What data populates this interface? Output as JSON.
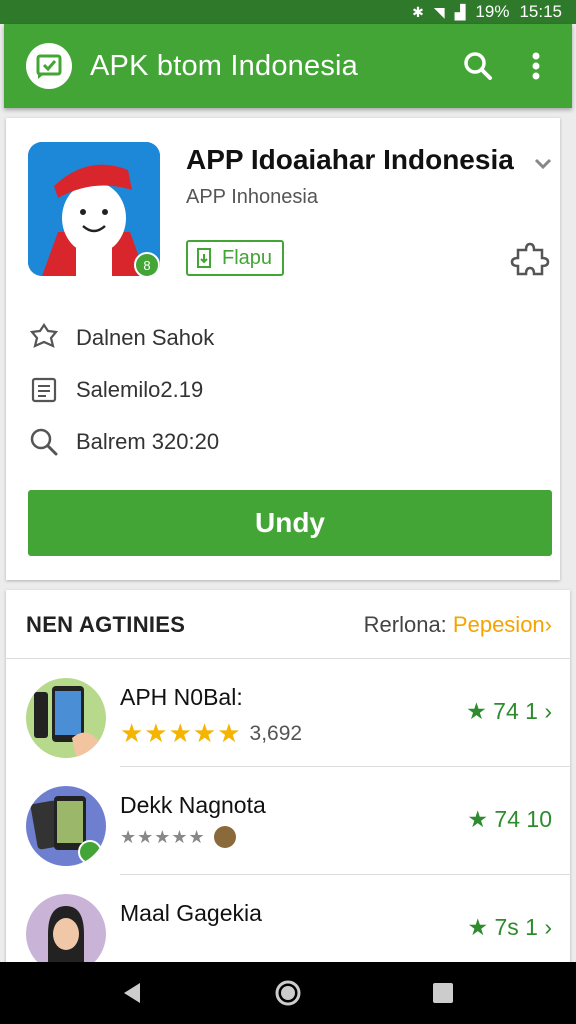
{
  "status_bar": {
    "battery": "19%",
    "time": "15:15"
  },
  "app_bar": {
    "title": "APK btom Indonesia"
  },
  "app": {
    "name": "APP Idoaiahar Indonesia",
    "developer": "APP Inhonesia",
    "flag_label": "Flapu",
    "info": [
      {
        "icon": "badge-icon",
        "text": "Dalnen Sahok"
      },
      {
        "icon": "document-icon",
        "text": "Salemilo2.19"
      },
      {
        "icon": "search-icon",
        "text": "Balrem 320:20"
      }
    ],
    "install_label": "Undy"
  },
  "section": {
    "title": "NEN AGTINIES",
    "more_prefix": "Rerlona: ",
    "more_highlight": "Pepesion",
    "more_arrow": "›"
  },
  "apps": [
    {
      "name": "APH N0Bal:",
      "stars": "★★★★★",
      "count": "3,692",
      "rating": "★ 74  1 ›"
    },
    {
      "name": "Dekk Nagnota",
      "stars": "★★★★★",
      "count": "",
      "rating": "★ 74  10"
    },
    {
      "name": "Maal Gagekia",
      "stars": "",
      "count": "",
      "rating": "★ 7s  1 ›"
    }
  ],
  "colors": {
    "primary": "#43a535",
    "status": "#2f7a2a",
    "star": "#f5b400",
    "highlight": "#f5a300"
  }
}
